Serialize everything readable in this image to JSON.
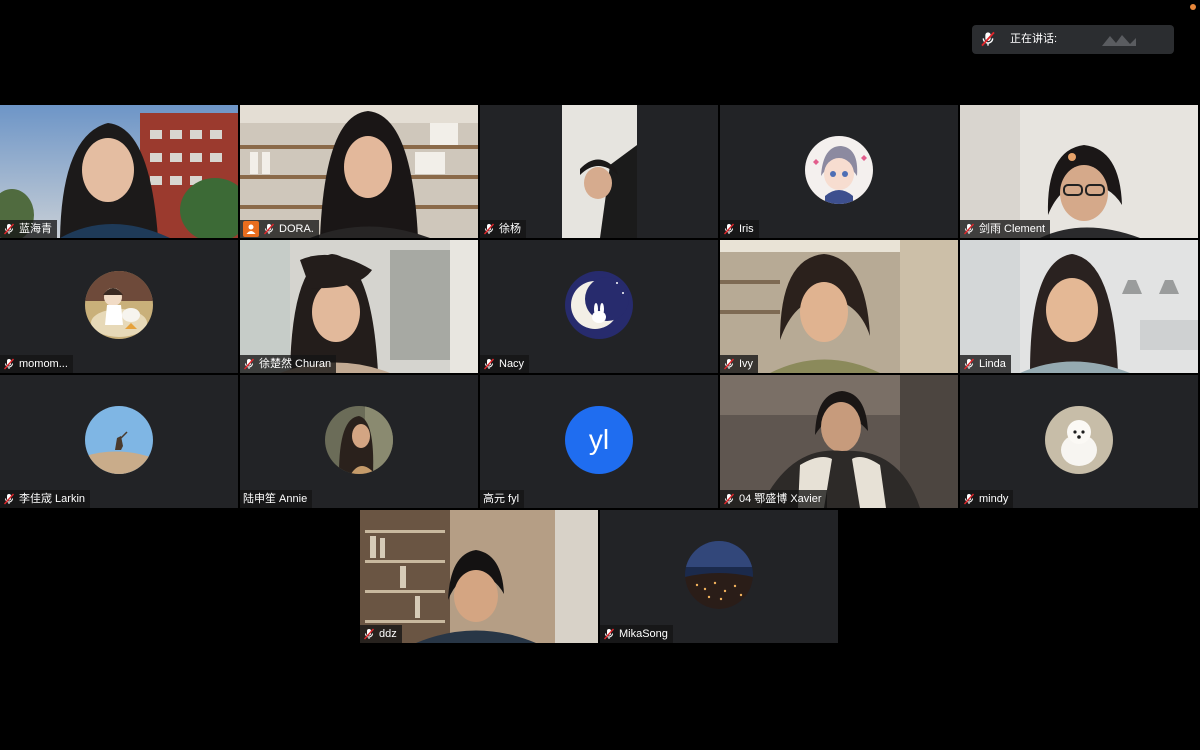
{
  "speaking_bar": {
    "label": "正在讲话:",
    "mic_icon": "mic-muted-icon"
  },
  "recording_indicator_color": "#e8873a",
  "tiles": [
    {
      "name": "蓝海青",
      "mic": "muted",
      "content": "video"
    },
    {
      "name": "DORA.",
      "mic": "muted",
      "content": "video",
      "host_badge": true
    },
    {
      "name": "徐杨",
      "mic": "muted",
      "content": "video"
    },
    {
      "name": "Iris",
      "mic": "muted",
      "content": "avatar"
    },
    {
      "name": "剑雨 Clement",
      "mic": "muted",
      "content": "video"
    },
    {
      "name": "momom...",
      "mic": "muted",
      "content": "avatar"
    },
    {
      "name": "徐楚然 Churan",
      "mic": "muted",
      "content": "video"
    },
    {
      "name": "Nacy",
      "mic": "muted",
      "content": "avatar"
    },
    {
      "name": "Ivy",
      "mic": "muted",
      "content": "video"
    },
    {
      "name": "Linda",
      "mic": "muted",
      "content": "video"
    },
    {
      "name": "李佳宬 Larkin",
      "mic": "muted",
      "content": "avatar"
    },
    {
      "name": "陆申笙 Annie",
      "mic": "none",
      "content": "avatar"
    },
    {
      "name": "高元 fyl",
      "mic": "none",
      "content": "initials",
      "initials": "yl"
    },
    {
      "name": "04 鄂盛博 Xavier",
      "mic": "muted",
      "content": "video"
    },
    {
      "name": "mindy",
      "mic": "muted",
      "content": "avatar"
    },
    {
      "name": "ddz",
      "mic": "muted",
      "content": "video"
    },
    {
      "name": "MikaSong",
      "mic": "muted",
      "content": "avatar"
    }
  ],
  "colors": {
    "background": "#000000",
    "tile_background": "#222326",
    "initials_avatar": "#1f6df0",
    "host_badge": "#e96d1e"
  }
}
